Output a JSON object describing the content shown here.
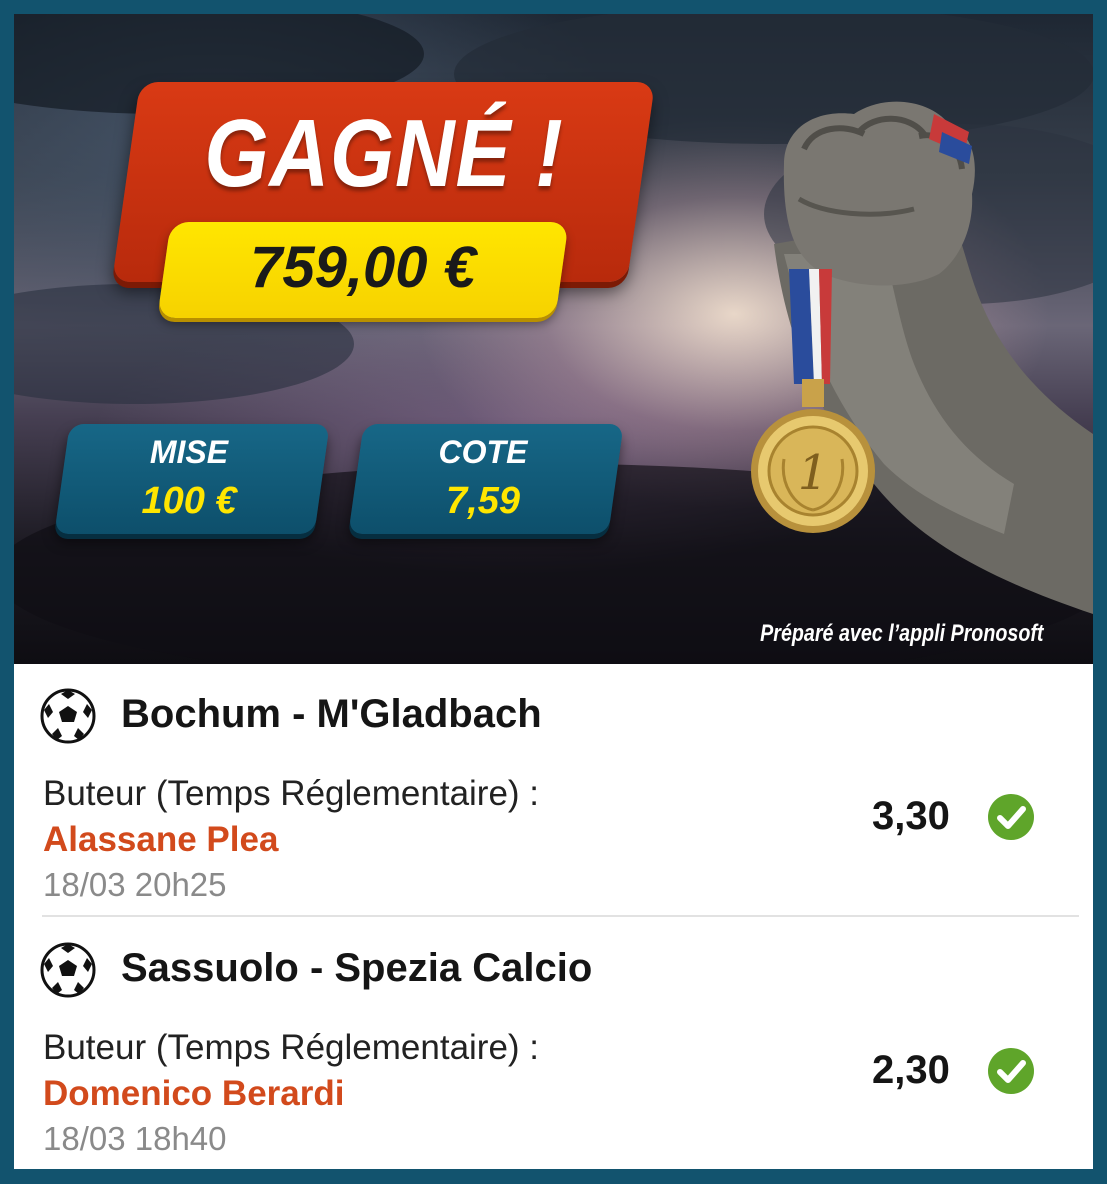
{
  "banner": {
    "headline": "GAGNÉ !",
    "amount": "759,00 €",
    "stake": {
      "label": "MISE",
      "value": "100 €"
    },
    "odds": {
      "label": "COTE",
      "value": "7,59"
    },
    "credit": "Préparé avec l’appli Pronosoft",
    "medal_number": "1"
  },
  "bets": [
    {
      "sport_icon": "soccer-ball-icon",
      "match": "Bochum - M'Gladbach",
      "market": "Buteur (Temps Réglementaire) :",
      "selection": "Alassane Plea",
      "datetime": "18/03 20h25",
      "odds": "3,30",
      "status": "won"
    },
    {
      "sport_icon": "soccer-ball-icon",
      "match": "Sassuolo - Spezia Calcio",
      "market": "Buteur (Temps Réglementaire) :",
      "selection": "Domenico Berardi",
      "datetime": "18/03 18h40",
      "odds": "2,30",
      "status": "won"
    }
  ],
  "colors": {
    "frame": "#12536e",
    "headline_bg": "#d33412",
    "amount_bg": "#ffe600",
    "stat_bg": "#125b7a",
    "selection_text": "#d24a1c",
    "check_green": "#5fa52a"
  }
}
